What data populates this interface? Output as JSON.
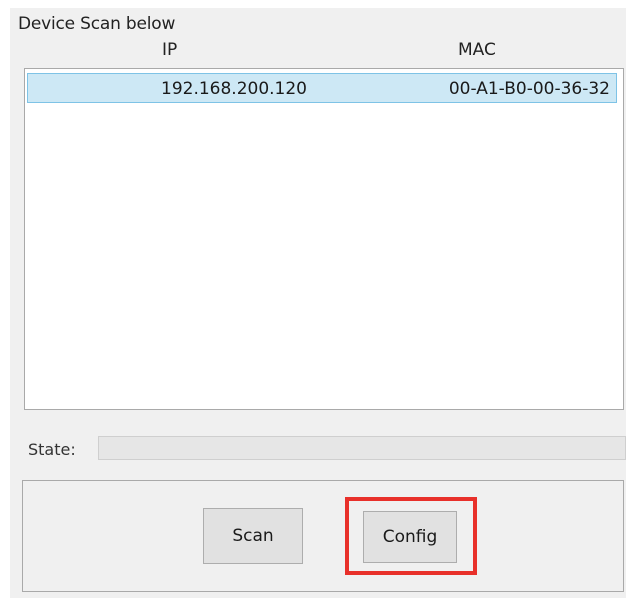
{
  "group": {
    "title": "Device Scan below"
  },
  "device_table": {
    "columns": [
      "IP",
      "MAC"
    ],
    "rows": [
      {
        "ip": "192.168.200.120",
        "mac": "00-A1-B0-00-36-32",
        "selected": true
      }
    ]
  },
  "state": {
    "label": "State:",
    "value": ""
  },
  "buttons": {
    "scan_label": "Scan",
    "config_label": "Config"
  },
  "colors": {
    "selection_background": "#cde8f5",
    "selection_border": "#7ec3e6",
    "highlight": "#e8302a"
  }
}
